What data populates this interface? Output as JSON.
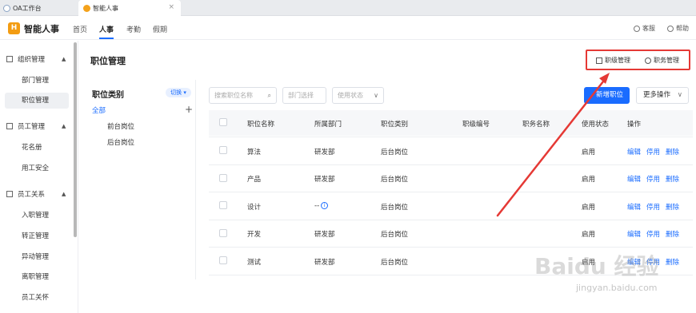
{
  "tabs": [
    {
      "label": "OA工作台"
    },
    {
      "label": "智能人事",
      "close": "×"
    }
  ],
  "header": {
    "logo": "H",
    "app_title": "智能人事",
    "nav": [
      "首页",
      "人事",
      "考勤",
      "假期"
    ],
    "active_nav": "人事",
    "service": "客服",
    "help": "帮助"
  },
  "sidebar": {
    "sections": [
      {
        "label": "组织管理",
        "items": [
          "部门管理",
          "职位管理"
        ]
      },
      {
        "label": "员工管理",
        "items": [
          "花名册",
          "用工安全"
        ]
      },
      {
        "label": "员工关系",
        "items": [
          "入职管理",
          "转正管理",
          "异动管理",
          "离职管理",
          "员工关怀"
        ]
      }
    ],
    "active_item": "职位管理"
  },
  "main": {
    "page_title": "职位管理",
    "toolbar": {
      "rank_mgmt": "职级管理",
      "duty_mgmt": "职务管理"
    },
    "category": {
      "title": "职位类别",
      "switch": "切换",
      "all": "全部",
      "plus": "+",
      "items": [
        "前台岗位",
        "后台岗位"
      ]
    },
    "filters": {
      "search_placeholder": "搜索职位名称",
      "dept_placeholder": "部门选择",
      "status_placeholder": "使用状态"
    },
    "new_button": "新增职位",
    "more_button": "更多操作",
    "columns": [
      "职位名称",
      "所属部门",
      "职位类别",
      "职级编号",
      "职务名称",
      "使用状态",
      "操作"
    ],
    "rows": [
      {
        "name": "算法",
        "dept": "研发部",
        "category": "后台岗位",
        "status": "启用"
      },
      {
        "name": "产品",
        "dept": "研发部",
        "category": "后台岗位",
        "status": "启用"
      },
      {
        "name": "设计",
        "dept": "--",
        "category": "后台岗位",
        "status": "启用"
      },
      {
        "name": "开发",
        "dept": "研发部",
        "category": "后台岗位",
        "status": "启用"
      },
      {
        "name": "测试",
        "dept": "研发部",
        "category": "后台岗位",
        "status": "启用"
      }
    ],
    "actions": {
      "edit": "编辑",
      "disable": "停用",
      "delete": "删除"
    }
  },
  "watermark": {
    "line1": "Baidu 经验",
    "line2": "jingyan.baidu.com"
  },
  "colors": {
    "accent": "#1a6cff",
    "highlight": "#e53935",
    "logo": "#f39c12"
  }
}
